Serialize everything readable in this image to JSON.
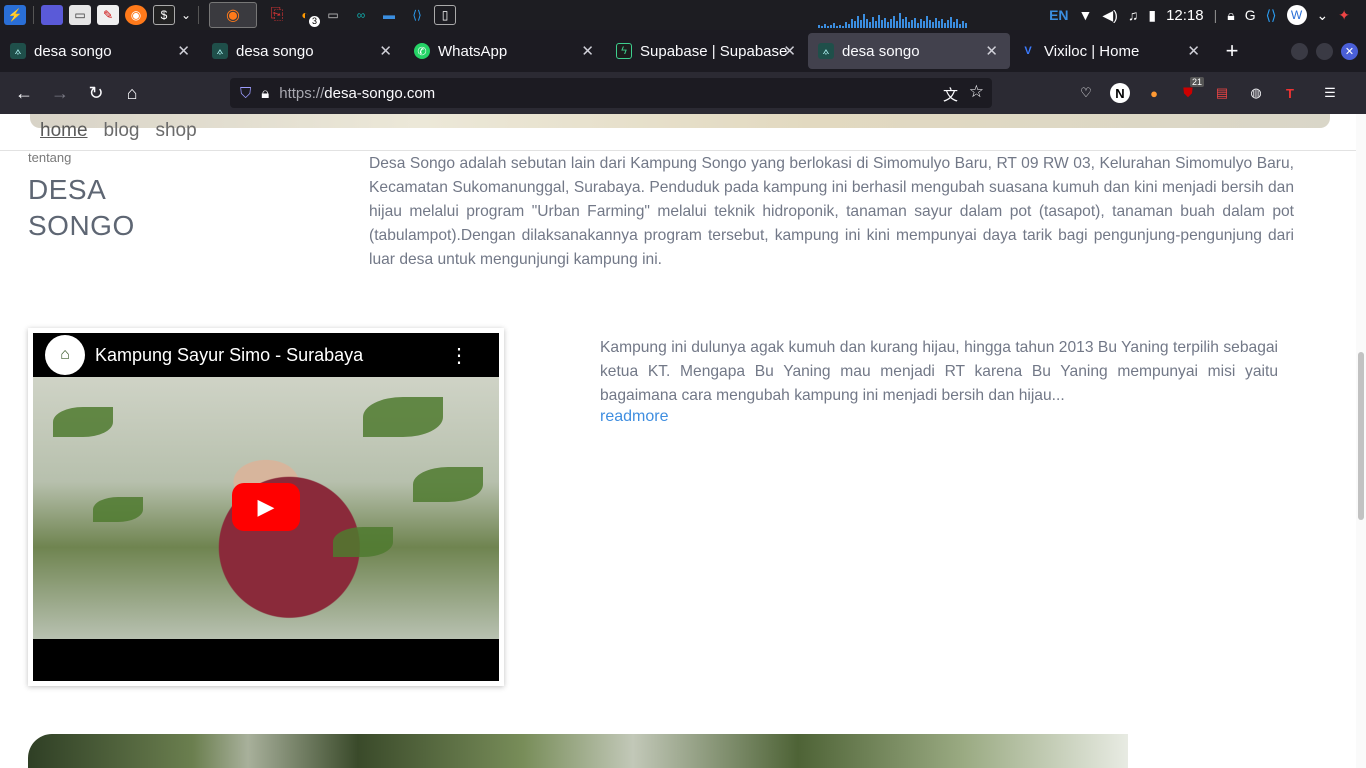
{
  "taskbar": {
    "language": "EN",
    "time": "12:18",
    "notification_count": "3"
  },
  "tabs": [
    {
      "title": "desa songo",
      "favicon": "desa-songo-favicon",
      "active": false
    },
    {
      "title": "desa songo",
      "favicon": "desa-songo-favicon",
      "active": false
    },
    {
      "title": "WhatsApp",
      "favicon": "whatsapp-favicon",
      "active": false
    },
    {
      "title": "Supabase | Supabase",
      "favicon": "supabase-favicon",
      "active": false
    },
    {
      "title": "desa songo",
      "favicon": "desa-songo-favicon",
      "active": true
    },
    {
      "title": "Vixiloc | Home",
      "favicon": "vixiloc-favicon",
      "active": false
    }
  ],
  "urlbar": {
    "scheme": "https://",
    "host": "desa-songo.com"
  },
  "extensions": {
    "ublock_badge": "21"
  },
  "site_nav": {
    "home": "home",
    "blog": "blog",
    "shop": "shop"
  },
  "about": {
    "kicker": "tentang",
    "title_line1": "DESA",
    "title_line2": "SONGO",
    "description": "Desa Songo adalah sebutan lain dari Kampung Songo yang berlokasi di Simomulyo Baru, RT 09 RW 03, Kelurahan Simomulyo Baru, Kecamatan Sukomanunggal, Surabaya. Penduduk pada kampung ini berhasil mengubah suasana kumuh dan kini menjadi bersih dan hijau melalui program \"Urban Farming\" melalui teknik hidroponik, tanaman sayur dalam pot (tasapot), tanaman buah dalam pot (tabulampot).Dengan dilaksanakannya program tersebut, kampung ini kini mempunyai daya tarik bagi pengunjung-pengunjung dari luar desa untuk mengunjungi kampung ini."
  },
  "video": {
    "title": "Kampung Sayur Simo - Surabaya"
  },
  "story": {
    "text": "Kampung ini dulunya agak kumuh dan kurang hijau, hingga tahun 2013 Bu Yaning terpilih sebagai ketua KT. Mengapa Bu Yaning mau menjadi RT karena Bu Yaning mempunyai misi yaitu bagaimana cara mengubah kampung ini menjadi bersih dan hijau...",
    "readmore": "readmore"
  },
  "colors": {
    "link": "#3f8ee0",
    "text": "#727887",
    "heading": "#5e6673",
    "browser_chrome": "#1c1b22",
    "active_tab": "#42414d"
  }
}
